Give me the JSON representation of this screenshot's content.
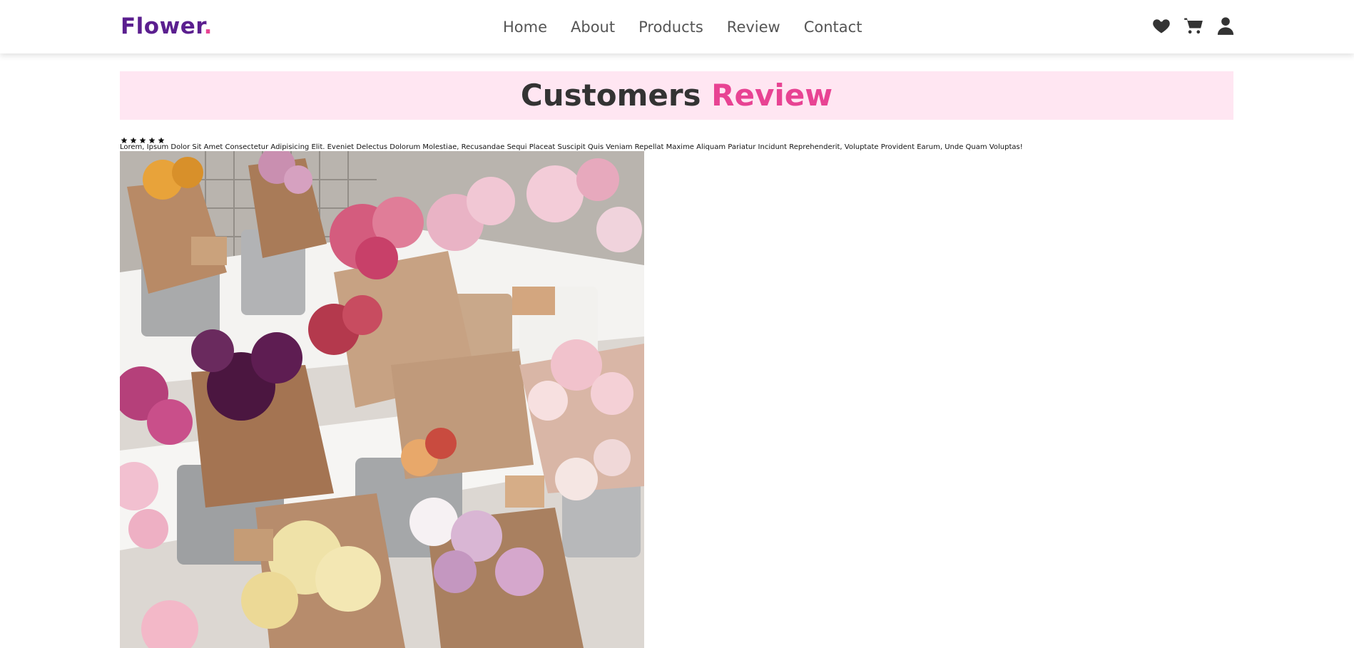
{
  "header": {
    "logo_text": "Flower",
    "logo_dot": ".",
    "nav": [
      "Home",
      "About",
      "Products",
      "Review",
      "Contact"
    ],
    "icons": [
      "heart-icon",
      "cart-icon",
      "user-icon"
    ]
  },
  "review_section": {
    "heading_main": "Customers",
    "heading_accent": "Review",
    "rating_stars": 5,
    "text": "Lorem, Ipsum Dolor Sit Amet Consectetur Adipisicing Elit. Eveniet Delectus Dolorum Molestiae, Recusandae Sequi Placeat Suscipit Quis Veniam Repellat Maxime Aliquam Pariatur Incidunt Reprehenderit, Voluptate Provident Earum, Unde Quam Voluptas!"
  },
  "colors": {
    "brand": "#5b1f8f",
    "accent": "#e84393",
    "heading_bg": "#ffe6f2"
  }
}
